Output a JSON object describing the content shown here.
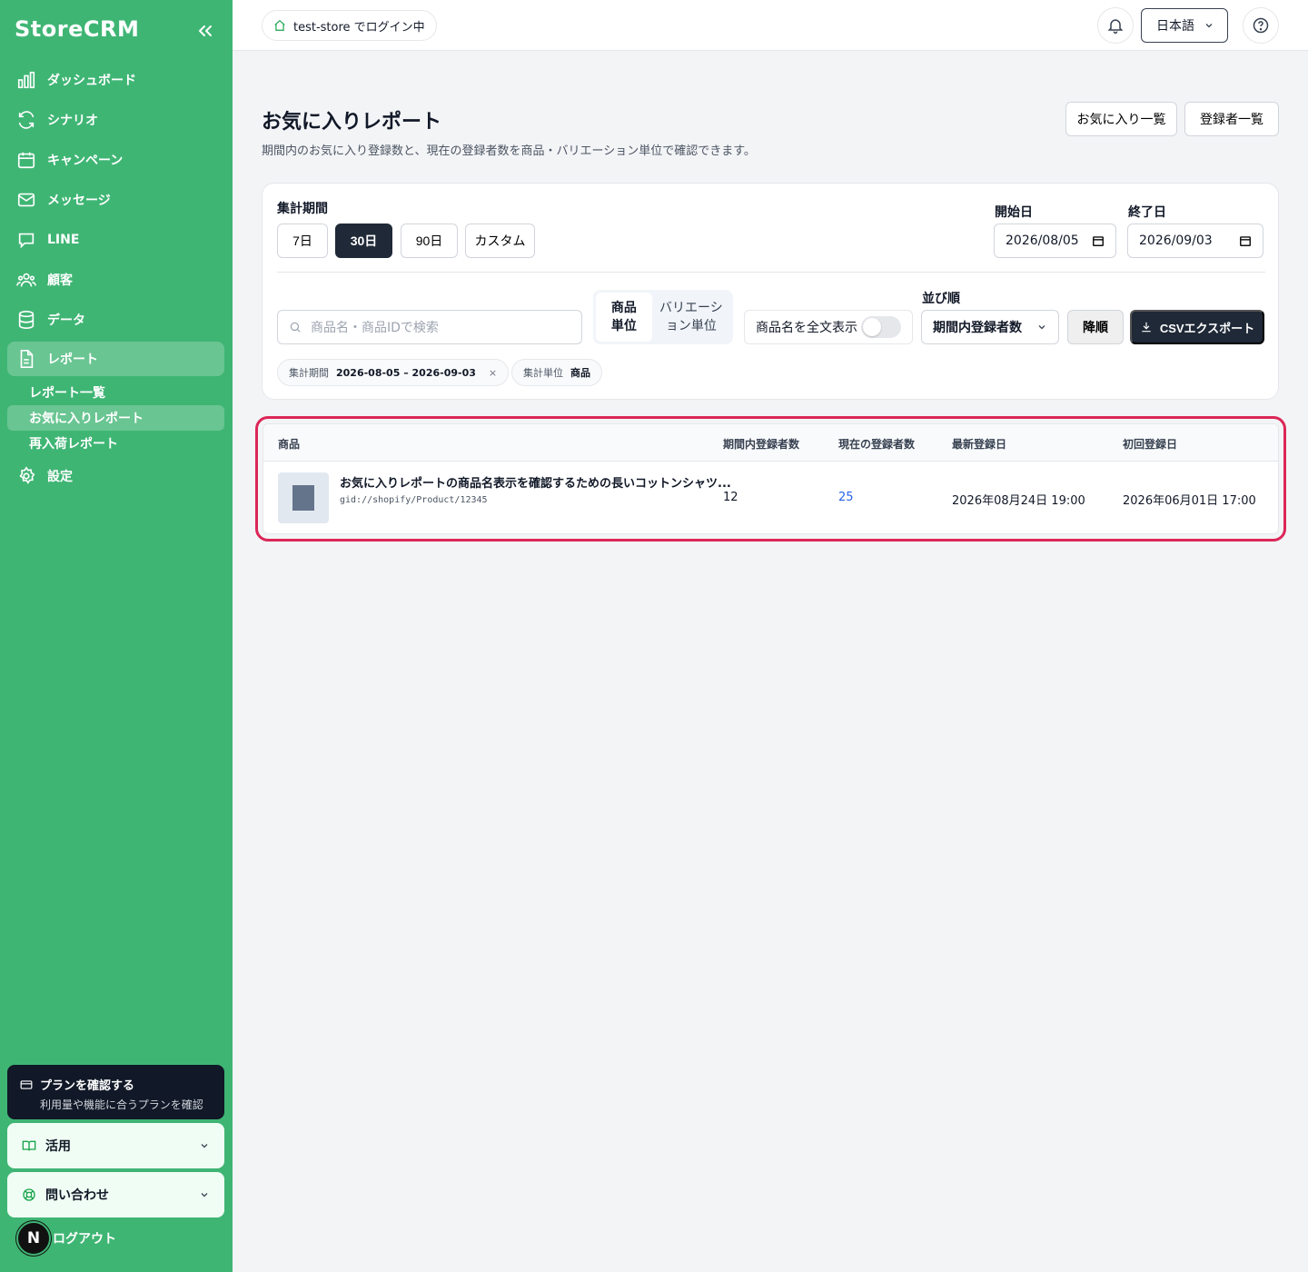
{
  "app": {
    "name": "StoreCRM"
  },
  "sidebar": {
    "items": [
      {
        "label": "ダッシュボード",
        "icon": "bar-chart-icon"
      },
      {
        "label": "シナリオ",
        "icon": "refresh-icon"
      },
      {
        "label": "キャンペーン",
        "icon": "calendar-icon"
      },
      {
        "label": "メッセージ",
        "icon": "mail-icon"
      },
      {
        "label": "LINE",
        "icon": "chat-icon"
      },
      {
        "label": "顧客",
        "icon": "users-icon"
      },
      {
        "label": "データ",
        "icon": "database-icon"
      },
      {
        "label": "レポート",
        "icon": "file-icon"
      }
    ],
    "report_sub": [
      "レポート一覧",
      "お気に入りレポート",
      "再入荷レポート"
    ],
    "settings": "設定",
    "plan": {
      "title": "プランを確認する",
      "subtitle": "利用量や機能に合うプランを確認"
    },
    "usage": "活用",
    "contact": "問い合わせ",
    "avatar": "N",
    "logout": "ログアウト"
  },
  "topbar": {
    "store": "test-store でログイン中",
    "language": "日本語"
  },
  "page": {
    "title": "お気に入りレポート",
    "description": "期間内のお気に入り登録数と、現在の登録者数を商品・バリエーション単位で確認できます。",
    "btn_favorites": "お気に入り一覧",
    "btn_registrants": "登録者一覧"
  },
  "filters": {
    "period_label": "集計期間",
    "periods": [
      "7日",
      "30日",
      "90日",
      "カスタム"
    ],
    "start_label": "開始日",
    "start_value": "2026/08/05",
    "end_label": "終了日",
    "end_value": "2026/09/03",
    "search_placeholder": "商品名・商品IDで検索",
    "unit_product": "商品\n単位",
    "unit_variation": "バリエーシ\nョン単位",
    "fulltext_label": "商品名を全文表示",
    "sort_label": "並び順",
    "sort_value": "期間内登録者数",
    "order": "降順",
    "csv": "CSVエクスポート",
    "chip1_label": "集計期間",
    "chip1_value": "2026-08-05 – 2026-09-03",
    "chip2_label": "集計単位",
    "chip2_value": "商品"
  },
  "table": {
    "headers": [
      "商品",
      "期間内登録者数",
      "現在の登録者数",
      "最新登録日",
      "初回登録日"
    ],
    "rows": [
      {
        "name": "お気に入りレポートの商品名表示を確認するための長いコットンシャツ...",
        "id": "gid://shopify/Product/12345",
        "period_count": "12",
        "current_count": "25",
        "latest": "2026年08月24日 19:00",
        "first": "2026年06月01日 17:00"
      }
    ]
  },
  "colors": {
    "sidebar": "#3fb574",
    "primary_dark": "#1f2937",
    "highlight": "#dc2657",
    "link": "#2563eb"
  }
}
